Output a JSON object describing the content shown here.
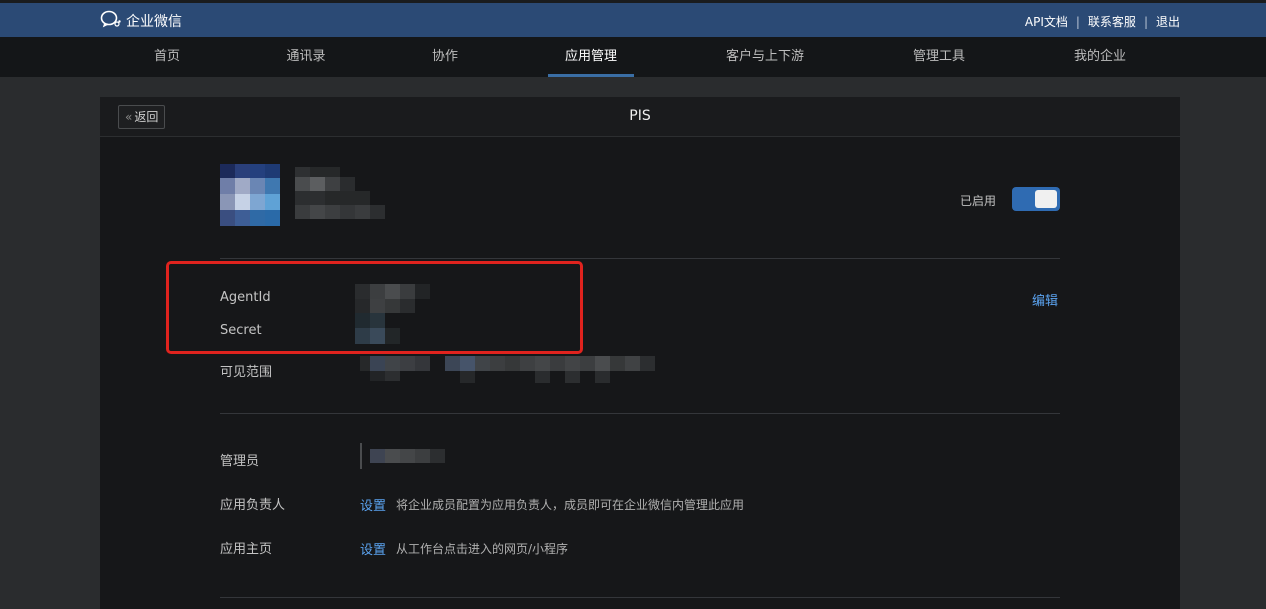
{
  "header": {
    "logo_text": "企业微信",
    "links": [
      "API文档",
      "联系客服",
      "退出"
    ]
  },
  "nav": {
    "items": [
      {
        "label": "首页",
        "active": false
      },
      {
        "label": "通讯录",
        "active": false
      },
      {
        "label": "协作",
        "active": false
      },
      {
        "label": "应用管理",
        "active": true
      },
      {
        "label": "客户与上下游",
        "active": false
      },
      {
        "label": "管理工具",
        "active": false
      },
      {
        "label": "我的企业",
        "active": false
      }
    ]
  },
  "panel": {
    "back_label": "返回",
    "title": "PIS"
  },
  "app": {
    "status_label": "已启用",
    "enabled": true
  },
  "details": {
    "agentid_label": "AgentId",
    "secret_label": "Secret",
    "edit_label": "编辑",
    "visible_range_label": "可见范围"
  },
  "management": {
    "admin_label": "管理员",
    "owner_label": "应用负责人",
    "owner_link": "设置",
    "owner_desc": "将企业成员配置为应用负责人，成员即可在企业微信内管理此应用",
    "homepage_label": "应用主页",
    "homepage_link": "设置",
    "homepage_desc": "从工作台点击进入的网页/小程序"
  },
  "colors": {
    "header_bg": "#2b4a75",
    "nav_bg": "#141618",
    "accent": "#2f6bb2",
    "link": "#5ba3f0",
    "highlight": "#e0231e"
  }
}
